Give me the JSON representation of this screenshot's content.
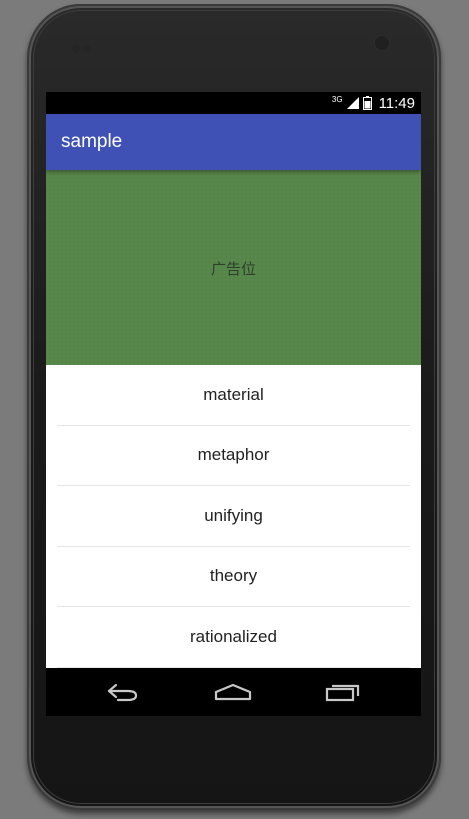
{
  "status_bar": {
    "network_type": "3G",
    "time": "11:49",
    "icons": [
      "signal-icon",
      "battery-icon"
    ]
  },
  "app_bar": {
    "title": "sample",
    "color": "#3f51b5"
  },
  "ad_banner": {
    "text": "广告位",
    "color": "#56854a"
  },
  "list": {
    "items": [
      {
        "label": "material"
      },
      {
        "label": "metaphor"
      },
      {
        "label": "unifying"
      },
      {
        "label": "theory"
      },
      {
        "label": "rationalized"
      }
    ]
  },
  "nav_bar": {
    "buttons": [
      "back-icon",
      "home-icon",
      "recents-icon"
    ]
  }
}
